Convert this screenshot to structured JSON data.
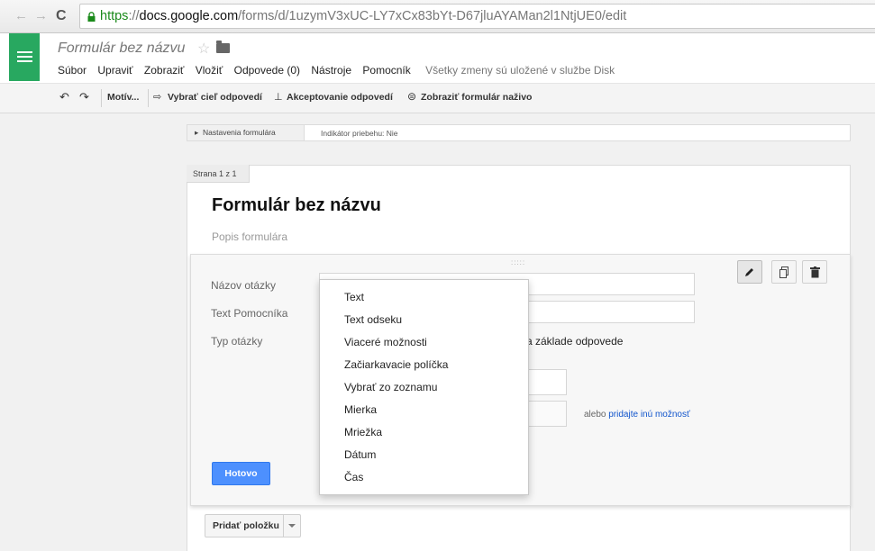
{
  "browser": {
    "url_scheme": "https",
    "url_sep": "://",
    "url_domain": "docs.google.com",
    "url_path": "/forms/d/1uzymV3xUC-LY7xCx83bYt-D67jluAYAMan2l1NtjUE0/edit"
  },
  "app": {
    "doc_title": "Formulár bez názvu",
    "brand_color": "#28a860"
  },
  "menu": {
    "items": [
      "Súbor",
      "Upraviť",
      "Zobraziť",
      "Vložiť",
      "Odpovede (0)",
      "Nástroje",
      "Pomocník"
    ],
    "save_status": "Všetky zmeny sú uložené v službe Disk"
  },
  "toolbar": {
    "theme": "Motív...",
    "destination": "Vybrať cieľ odpovedí",
    "accepting": "Akceptovanie odpovedí",
    "view_live": "Zobraziť formulár naživo"
  },
  "settings": {
    "label": "Nastavenia formulára",
    "progress": "Indikátor priebehu: Nie"
  },
  "form": {
    "page_label": "Strana 1 z 1",
    "title": "Formulár bez názvu",
    "description_placeholder": "Popis formulára"
  },
  "question": {
    "title_label": "Názov otázky",
    "help_label": "Text Pomocníka",
    "type_label": "Typ otázky",
    "type_suffix": "a základe odpovede",
    "add_other_prefix": "alebo",
    "add_other_link": "pridajte inú možnosť",
    "done_button": "Hotovo"
  },
  "question_types": [
    "Text",
    "Text odseku",
    "Viaceré možnosti",
    "Začiarkavacie políčka",
    "Vybrať zo zoznamu",
    "Mierka",
    "Mriežka",
    "Dátum",
    "Čas"
  ],
  "add_item": {
    "label": "Pridať položku"
  },
  "icons": [
    "back-arrow-icon",
    "forward-arrow-icon",
    "reload-icon",
    "lock-icon",
    "star-icon",
    "folder-icon",
    "undo-icon",
    "redo-icon",
    "pencil-icon",
    "duplicate-icon",
    "trash-icon",
    "dropdown-arrow-icon"
  ]
}
